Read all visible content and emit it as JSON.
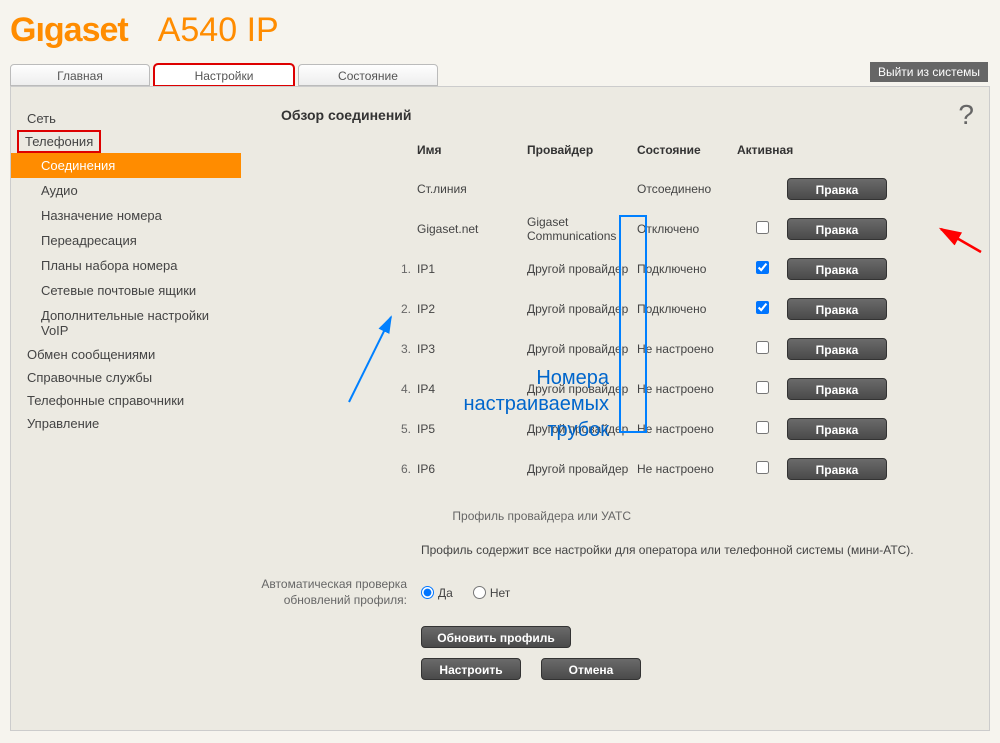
{
  "brand": "Gıgaset",
  "model": "A540 IP",
  "tabs": {
    "main": "Главная",
    "settings": "Настройки",
    "status": "Состояние"
  },
  "logout": "Выйти из системы",
  "sidebar": {
    "network": "Сеть",
    "telephony": "Телефония",
    "telephony_items": {
      "connections": "Соединения",
      "audio": "Аудио",
      "number_assign": "Назначение номера",
      "forwarding": "Переадресация",
      "dial_plans": "Планы набора номера",
      "net_mailboxes": "Сетевые почтовые ящики",
      "voip_advanced": "Дополнительные настройки VoIP"
    },
    "messaging": "Обмен сообщениями",
    "info_services": "Справочные службы",
    "phone_dirs": "Телефонные справочники",
    "management": "Управление"
  },
  "page_title": "Обзор соединений",
  "columns": {
    "name": "Имя",
    "provider": "Провайдер",
    "status": "Состояние",
    "active": "Активная"
  },
  "rows": {
    "fixed": {
      "name": "Ст.линия",
      "provider": "",
      "status": "Отсоединено",
      "checkbox": false
    },
    "gigaset": {
      "name": "Gigaset.net",
      "provider": "Gigaset Communications",
      "status": "Отключено",
      "checkbox": true,
      "checked": false
    },
    "ip1": {
      "num": "1.",
      "name": "IP1",
      "provider": "Другой провайдер",
      "status": "Подключено",
      "checked": true
    },
    "ip2": {
      "num": "2.",
      "name": "IP2",
      "provider": "Другой провайдер",
      "status": "Подключено",
      "checked": true
    },
    "ip3": {
      "num": "3.",
      "name": "IP3",
      "provider": "Другой провайдер",
      "status": "Не настроено",
      "checked": false
    },
    "ip4": {
      "num": "4.",
      "name": "IP4",
      "provider": "Другой провайдер",
      "status": "Не настроено",
      "checked": false
    },
    "ip5": {
      "num": "5.",
      "name": "IP5",
      "provider": "Другой провайдер",
      "status": "Не настроено",
      "checked": false
    },
    "ip6": {
      "num": "6.",
      "name": "IP6",
      "provider": "Другой провайдер",
      "status": "Не настроено",
      "checked": false
    }
  },
  "edit_label": "Правка",
  "section_label": "Профиль провайдера или УАТС",
  "profile_desc": "Профиль содержит все настройки для оператора или телефонной системы (мини-АТС).",
  "auto_update_label": "Автоматическая проверка обновлений профиля:",
  "yes": "Да",
  "no": "Нет",
  "update_profile": "Обновить профиль",
  "configure": "Настроить",
  "cancel": "Отмена",
  "annotation": "Номера настраиваемых трубок"
}
